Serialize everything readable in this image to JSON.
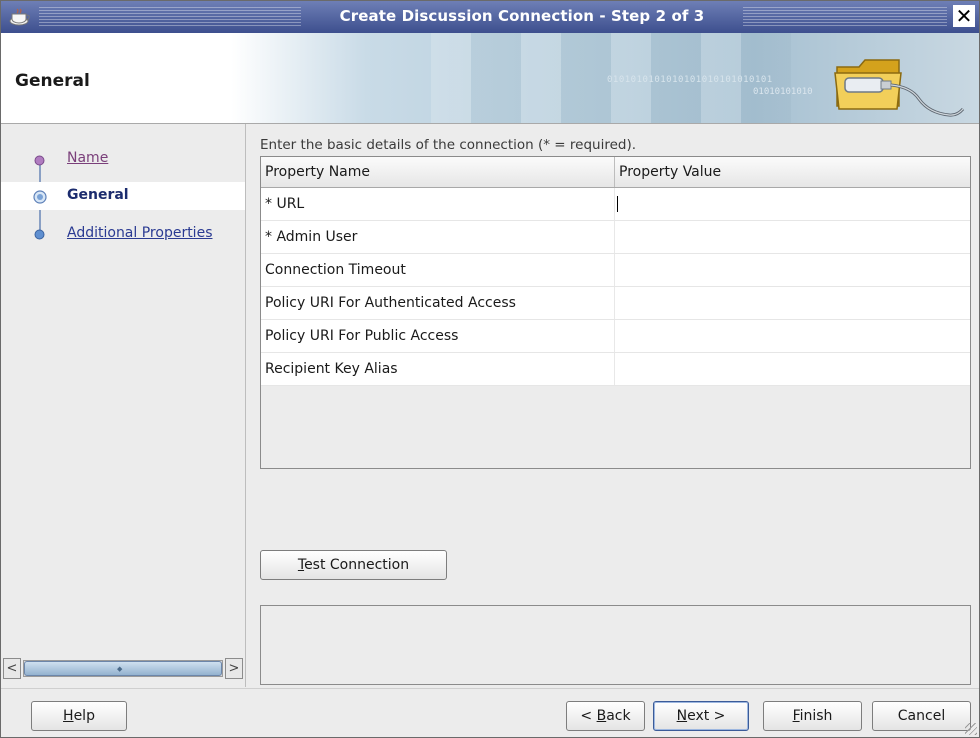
{
  "window": {
    "title": "Create Discussion Connection - Step 2 of 3",
    "close_glyph": "✕"
  },
  "header": {
    "page_title": "General",
    "banner_binary_1": "0101010101010101010101010101",
    "banner_binary_2": "01010101010"
  },
  "nav": {
    "items": [
      {
        "label": "Name",
        "state": "visited"
      },
      {
        "label": "General",
        "state": "current"
      },
      {
        "label": "Additional Properties",
        "state": "link"
      }
    ],
    "scroll_left": "<",
    "scroll_right": ">"
  },
  "main": {
    "instruction": "Enter the basic details of the connection (* = required).",
    "table": {
      "columns": [
        "Property Name",
        "Property Value"
      ],
      "rows": [
        {
          "name": "* URL",
          "value": ""
        },
        {
          "name": "* Admin User",
          "value": ""
        },
        {
          "name": "Connection Timeout",
          "value": ""
        },
        {
          "name": "Policy URI For Authenticated Access",
          "value": ""
        },
        {
          "name": "Policy URI For Public Access",
          "value": ""
        },
        {
          "name": "Recipient Key Alias",
          "value": ""
        }
      ]
    },
    "test_button": {
      "mnemonic": "T",
      "rest": "est Connection"
    }
  },
  "footer": {
    "help": {
      "mnemonic": "H",
      "rest": "elp"
    },
    "back": {
      "prefix": "< ",
      "mnemonic": "B",
      "rest": "ack"
    },
    "next": {
      "mnemonic": "N",
      "rest": "ext >"
    },
    "finish": {
      "mnemonic": "F",
      "rest": "inish"
    },
    "cancel": "Cancel"
  },
  "colors": {
    "titlebar": "#4b5c9a",
    "nav_link": "#2a3a92",
    "nav_visited": "#7a3f7a",
    "nav_current": "#1c2c6e"
  },
  "icons": [
    "app-cup-icon",
    "close-icon",
    "folder-connection-icon",
    "scroll-left-icon",
    "scroll-right-icon",
    "resize-grip-icon"
  ]
}
